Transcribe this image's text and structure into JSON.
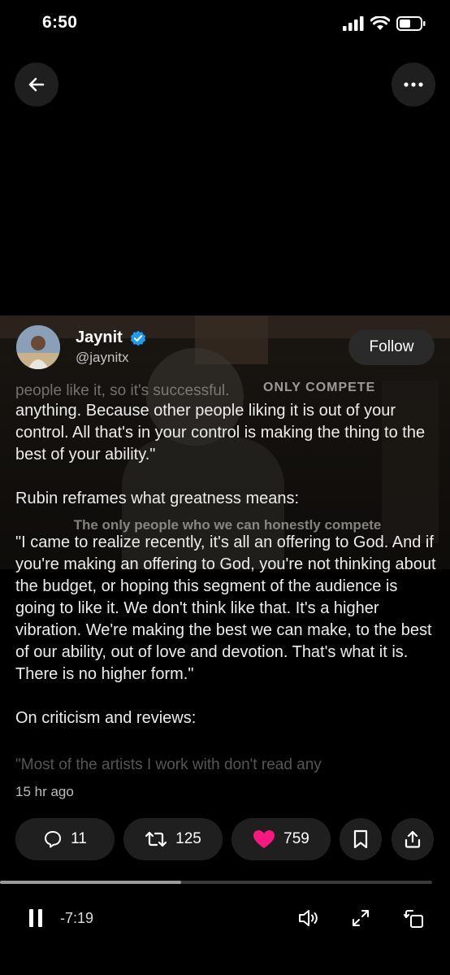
{
  "status_bar": {
    "time": "6:50"
  },
  "video": {
    "overlay_caption": "The only people who we can honestly compete",
    "overlay_top": "ONLY COMPETE"
  },
  "author": {
    "name": "Jaynit",
    "handle": "@jaynitx",
    "verified_color": "#1D9BF0",
    "follow_label": "Follow"
  },
  "post": {
    "faded_top": "people like it, so it's successful.",
    "paragraphs": [
      "anything. Because other people liking it is out of your control. All that's in your control is making the thing to the best of your ability.\"",
      "Rubin reframes what greatness means:",
      "\"I came to realize recently, it's all an offering to God. And if you're making an offering to God, you're not thinking about the budget, or hoping this segment of the audience is going to like it. We don't think like that. It's a higher vibration. We're making the best we can make, to the best of our ability, out of love and devotion. That's what it is. There is no higher form.\"",
      "On criticism and reviews:"
    ],
    "faded_bottom": "\"Most of the artists I work with don't read any",
    "timestamp": "15 hr ago"
  },
  "actions": {
    "replies": "11",
    "reposts": "125",
    "likes": "759",
    "like_color": "#F91880"
  },
  "player": {
    "time_remaining": "-7:19",
    "progress": 0.42
  },
  "icons": [
    "back-arrow-icon",
    "more-icon",
    "verified-icon",
    "reply-icon",
    "repost-icon",
    "heart-icon",
    "bookmark-icon",
    "share-icon",
    "pause-icon",
    "volume-icon",
    "expand-icon",
    "rotate-icon",
    "signal-icon",
    "wifi-icon",
    "battery-icon"
  ]
}
